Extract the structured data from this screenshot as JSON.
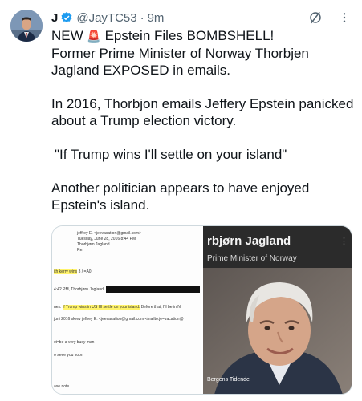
{
  "author": {
    "name": "J",
    "handle": "@JayTC53",
    "separator": "·",
    "time": "9m"
  },
  "icons": {
    "verified": "verified-badge-icon",
    "grok": "grok-icon",
    "more": "more-options-icon",
    "siren": "police-light-emoji"
  },
  "tweet": {
    "line1_prefix": "NEW",
    "line1_suffix": "Epstein Files BOMBSHELL!",
    "line2": "Former Prime Minister of Norway Thorbjen Jagland EXPOSED in emails.",
    "para2": "In 2016, Thorbjon emails Jeffery Epstein panicked about a Trump election victory.",
    "para3": "\"If Trump wins I'll settle on your island\"",
    "para4": "Another politician appears to have enjoyed Epstein's island."
  },
  "media": {
    "email": {
      "from": "jeffrey E. <jeevacation@gmail.com>",
      "date": "Tuesday, June 28, 2016 8:44 PM",
      "to": "Thorbjørn Jagland",
      "re": "Re:",
      "kerry_hl": "ith kerry wins",
      "kerry_rest": "3 / =A0",
      "stamp": "4:42 PM, Thorbjørn Jagland",
      "nes": "nes.",
      "quote_hl": "If Trump wins in US I'll settle on your island.",
      "quote_rest": "Before that, I'll be in Ni",
      "juni": "juni 2016 skrev jeffrey E. <jeevacation@gmail.com <mailto:je=vacation@",
      "busy": "ct=be a very busy man",
      "see": "o seee you soon",
      "note": "ase note"
    },
    "photo": {
      "name": "rbjørn Jagland",
      "role": "Prime Minister of Norway",
      "credit": "Bergens Tidende",
      "more": "⋮"
    }
  },
  "colors": {
    "verified": "#1d9bf0",
    "text": "#0f1419",
    "muted": "#536471",
    "highlight": "#fff36b"
  }
}
